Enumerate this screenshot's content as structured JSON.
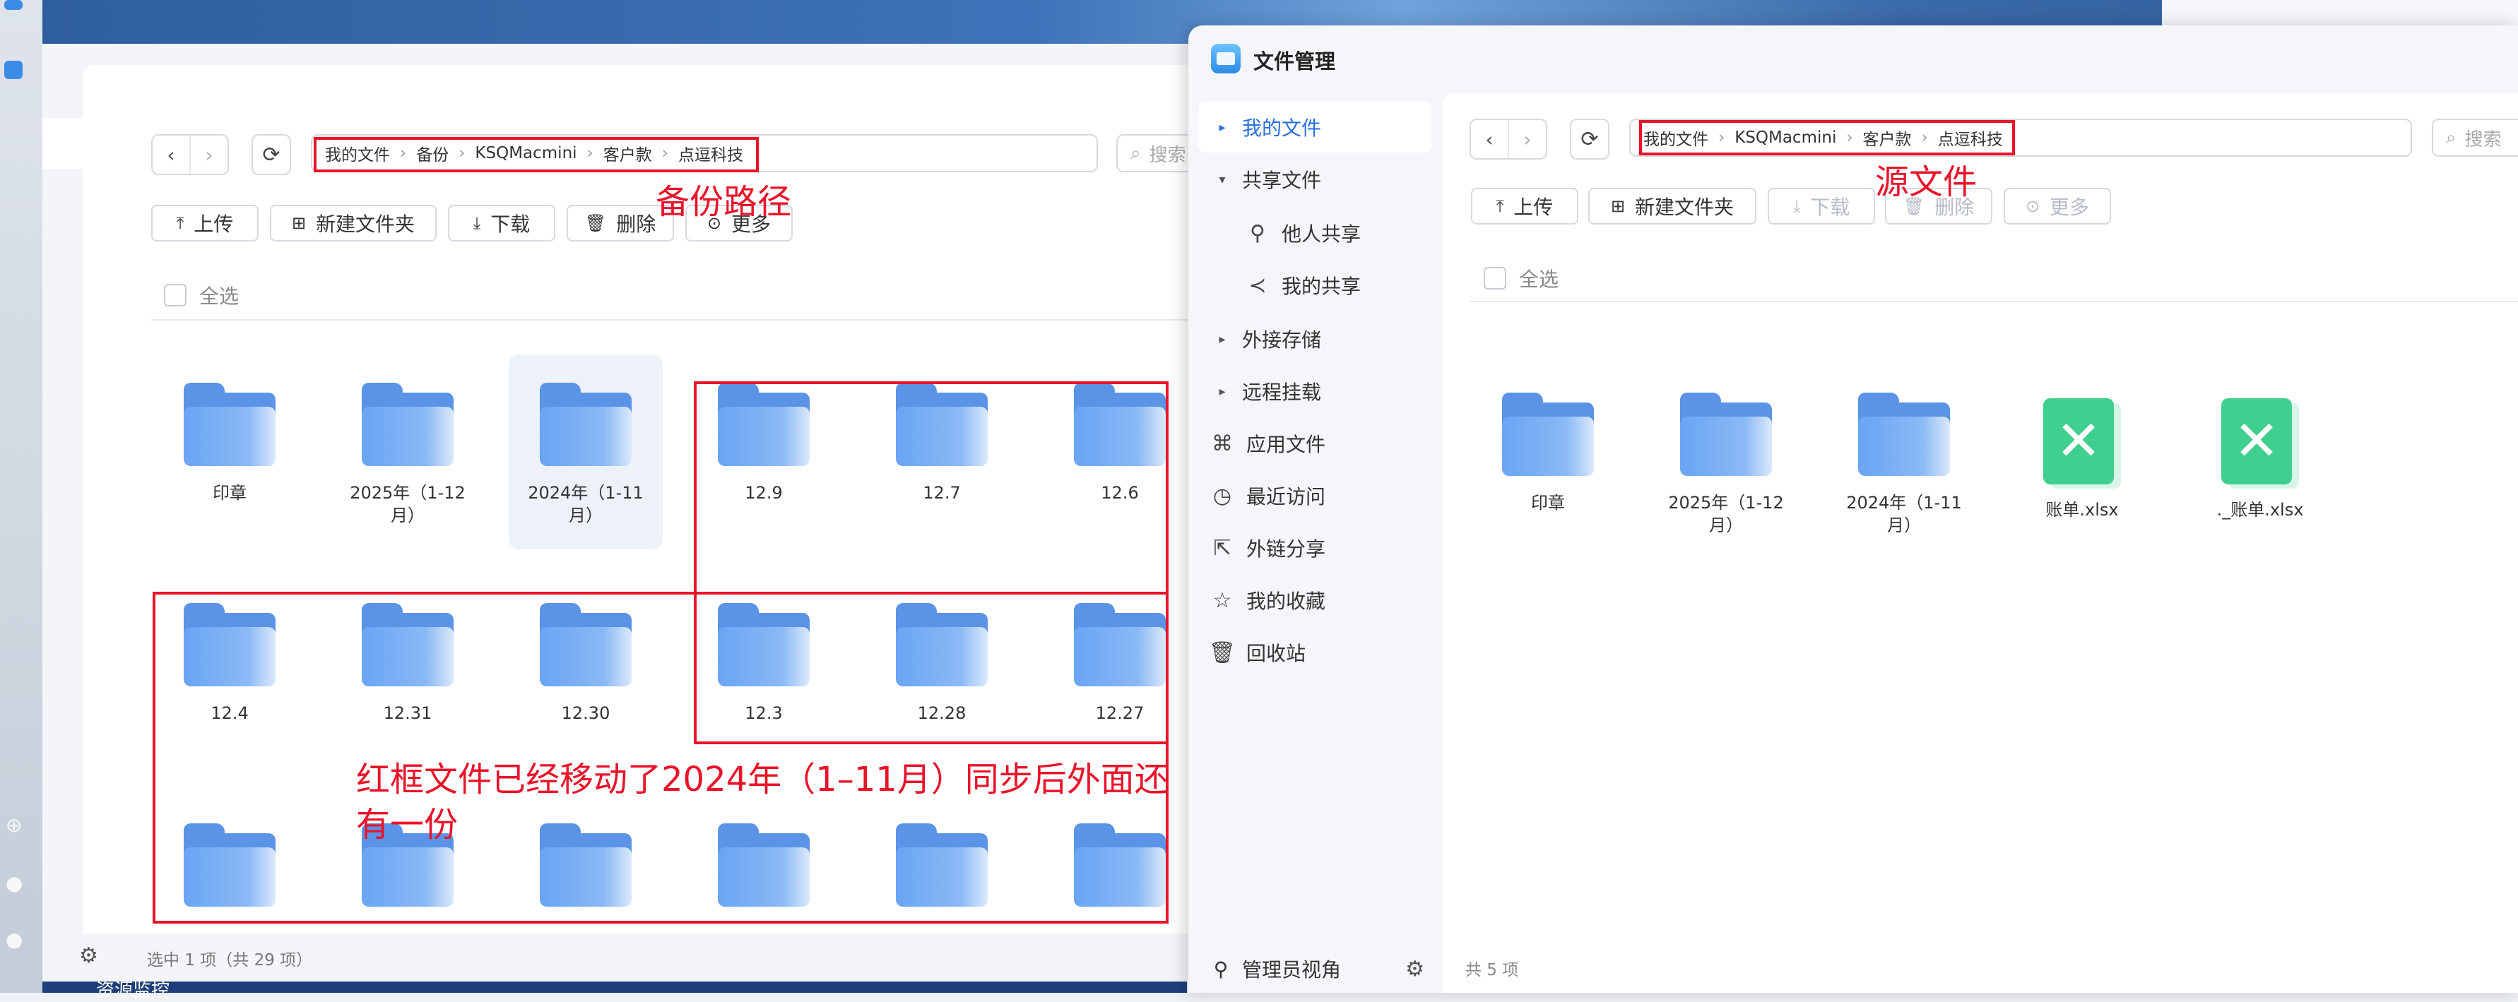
{
  "desktop": {
    "taskbar_label": "资源监控"
  },
  "back_window": {
    "path": [
      "我的文件",
      "备份",
      "KSQMacmini",
      "客户款",
      "点逗科技"
    ],
    "search_placeholder": "搜索",
    "toolbar": {
      "upload": "上传",
      "new_folder": "新建文件夹",
      "download": "下载",
      "delete": "删除",
      "more": "更多"
    },
    "select_all": "全选",
    "items": [
      {
        "name": "印章",
        "type": "folder",
        "selected": false
      },
      {
        "name": "2025年（1-12月）",
        "type": "folder",
        "selected": false
      },
      {
        "name": "2024年（1-11月）",
        "type": "folder",
        "selected": true
      },
      {
        "name": "12.9",
        "type": "folder",
        "selected": false
      },
      {
        "name": "12.7",
        "type": "folder",
        "selected": false
      },
      {
        "name": "12.6",
        "type": "folder",
        "selected": false
      },
      {
        "name": "12.4",
        "type": "folder",
        "selected": false
      },
      {
        "name": "12.31",
        "type": "folder",
        "selected": false
      },
      {
        "name": "12.30",
        "type": "folder",
        "selected": false
      },
      {
        "name": "12.3",
        "type": "folder",
        "selected": false
      },
      {
        "name": "12.28",
        "type": "folder",
        "selected": false
      },
      {
        "name": "12.27",
        "type": "folder",
        "selected": false
      },
      {
        "name": "",
        "type": "folder",
        "selected": false
      },
      {
        "name": "",
        "type": "folder",
        "selected": false
      },
      {
        "name": "",
        "type": "folder",
        "selected": false
      },
      {
        "name": "",
        "type": "folder",
        "selected": false
      },
      {
        "name": "",
        "type": "folder",
        "selected": false
      },
      {
        "name": "",
        "type": "folder",
        "selected": false
      }
    ],
    "status": "选中 1 项（共 29 项）"
  },
  "annotations": {
    "backup_path": "备份路径",
    "source_file": "源文件",
    "note": "红框文件已经移动了2024年（1–11月）同步后外面还有一份",
    "color": "#e8142a"
  },
  "front_window": {
    "title": "文件管理",
    "sidebar": [
      {
        "label": "我的文件",
        "icon": "caret-right-icon",
        "active": true
      },
      {
        "label": "共享文件",
        "icon": "caret-down-icon",
        "active": false
      },
      {
        "label": "他人共享",
        "icon": "user-icon",
        "active": false
      },
      {
        "label": "我的共享",
        "icon": "share-icon",
        "active": false
      },
      {
        "label": "外接存储",
        "icon": "caret-right-icon",
        "active": false
      },
      {
        "label": "远程挂载",
        "icon": "caret-right-icon",
        "active": false
      },
      {
        "label": "应用文件",
        "icon": "apps-icon",
        "active": false
      },
      {
        "label": "最近访问",
        "icon": "clock-icon",
        "active": false
      },
      {
        "label": "外链分享",
        "icon": "external-link-icon",
        "active": false
      },
      {
        "label": "我的收藏",
        "icon": "star-icon",
        "active": false
      },
      {
        "label": "回收站",
        "icon": "trash-icon",
        "active": false
      }
    ],
    "admin_view": "管理员视角",
    "path": [
      "我的文件",
      "KSQMacmini",
      "客户款",
      "点逗科技"
    ],
    "search_placeholder": "搜索",
    "toolbar": {
      "upload": "上传",
      "new_folder": "新建文件夹",
      "download": "下载",
      "delete": "删除",
      "more": "更多"
    },
    "select_all": "全选",
    "items": [
      {
        "name": "印章",
        "type": "folder"
      },
      {
        "name": "2025年（1-12月）",
        "type": "folder"
      },
      {
        "name": "2024年（1-11月）",
        "type": "folder"
      },
      {
        "name": "账单.xlsx",
        "type": "xlsx"
      },
      {
        "name": "._账单.xlsx",
        "type": "xlsx"
      }
    ],
    "status": "共 5 项"
  }
}
